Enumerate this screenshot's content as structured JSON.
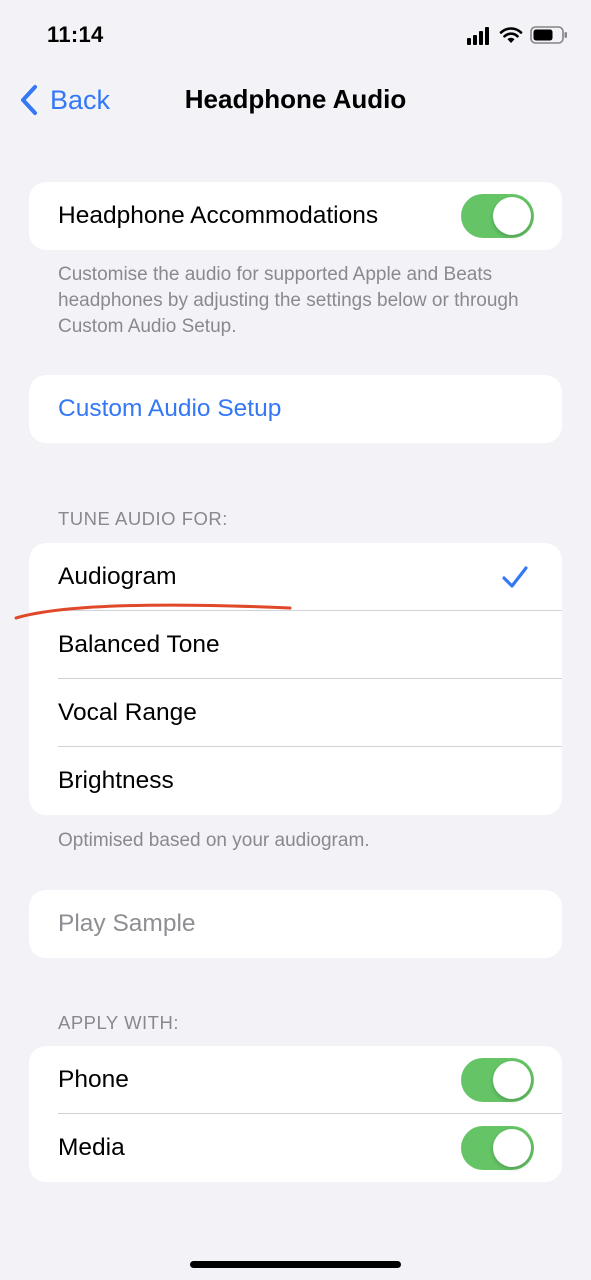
{
  "status_bar": {
    "time": "11:14"
  },
  "nav": {
    "back_label": "Back",
    "title": "Headphone Audio"
  },
  "accommodations": {
    "label": "Headphone Accommodations",
    "enabled": true,
    "note": "Customise the audio for supported Apple and Beats headphones by adjusting the settings below or through Custom Audio Setup."
  },
  "custom_setup": {
    "label": "Custom Audio Setup"
  },
  "tune_audio": {
    "header": "TUNE AUDIO FOR:",
    "options": [
      {
        "label": "Audiogram",
        "selected": true
      },
      {
        "label": "Balanced Tone",
        "selected": false
      },
      {
        "label": "Vocal Range",
        "selected": false
      },
      {
        "label": "Brightness",
        "selected": false
      }
    ],
    "note": "Optimised based on your audiogram."
  },
  "play_sample": {
    "label": "Play Sample"
  },
  "apply_with": {
    "header": "APPLY WITH:",
    "items": [
      {
        "label": "Phone",
        "enabled": true
      },
      {
        "label": "Media",
        "enabled": true
      }
    ]
  },
  "colors": {
    "accent": "#3478f6",
    "toggle_on": "#65c466",
    "background": "#f2f2f7",
    "annotation": "#e0482a"
  },
  "icons": [
    "cellular-signal-icon",
    "wifi-icon",
    "battery-icon",
    "chevron-left-icon",
    "checkmark-icon"
  ]
}
